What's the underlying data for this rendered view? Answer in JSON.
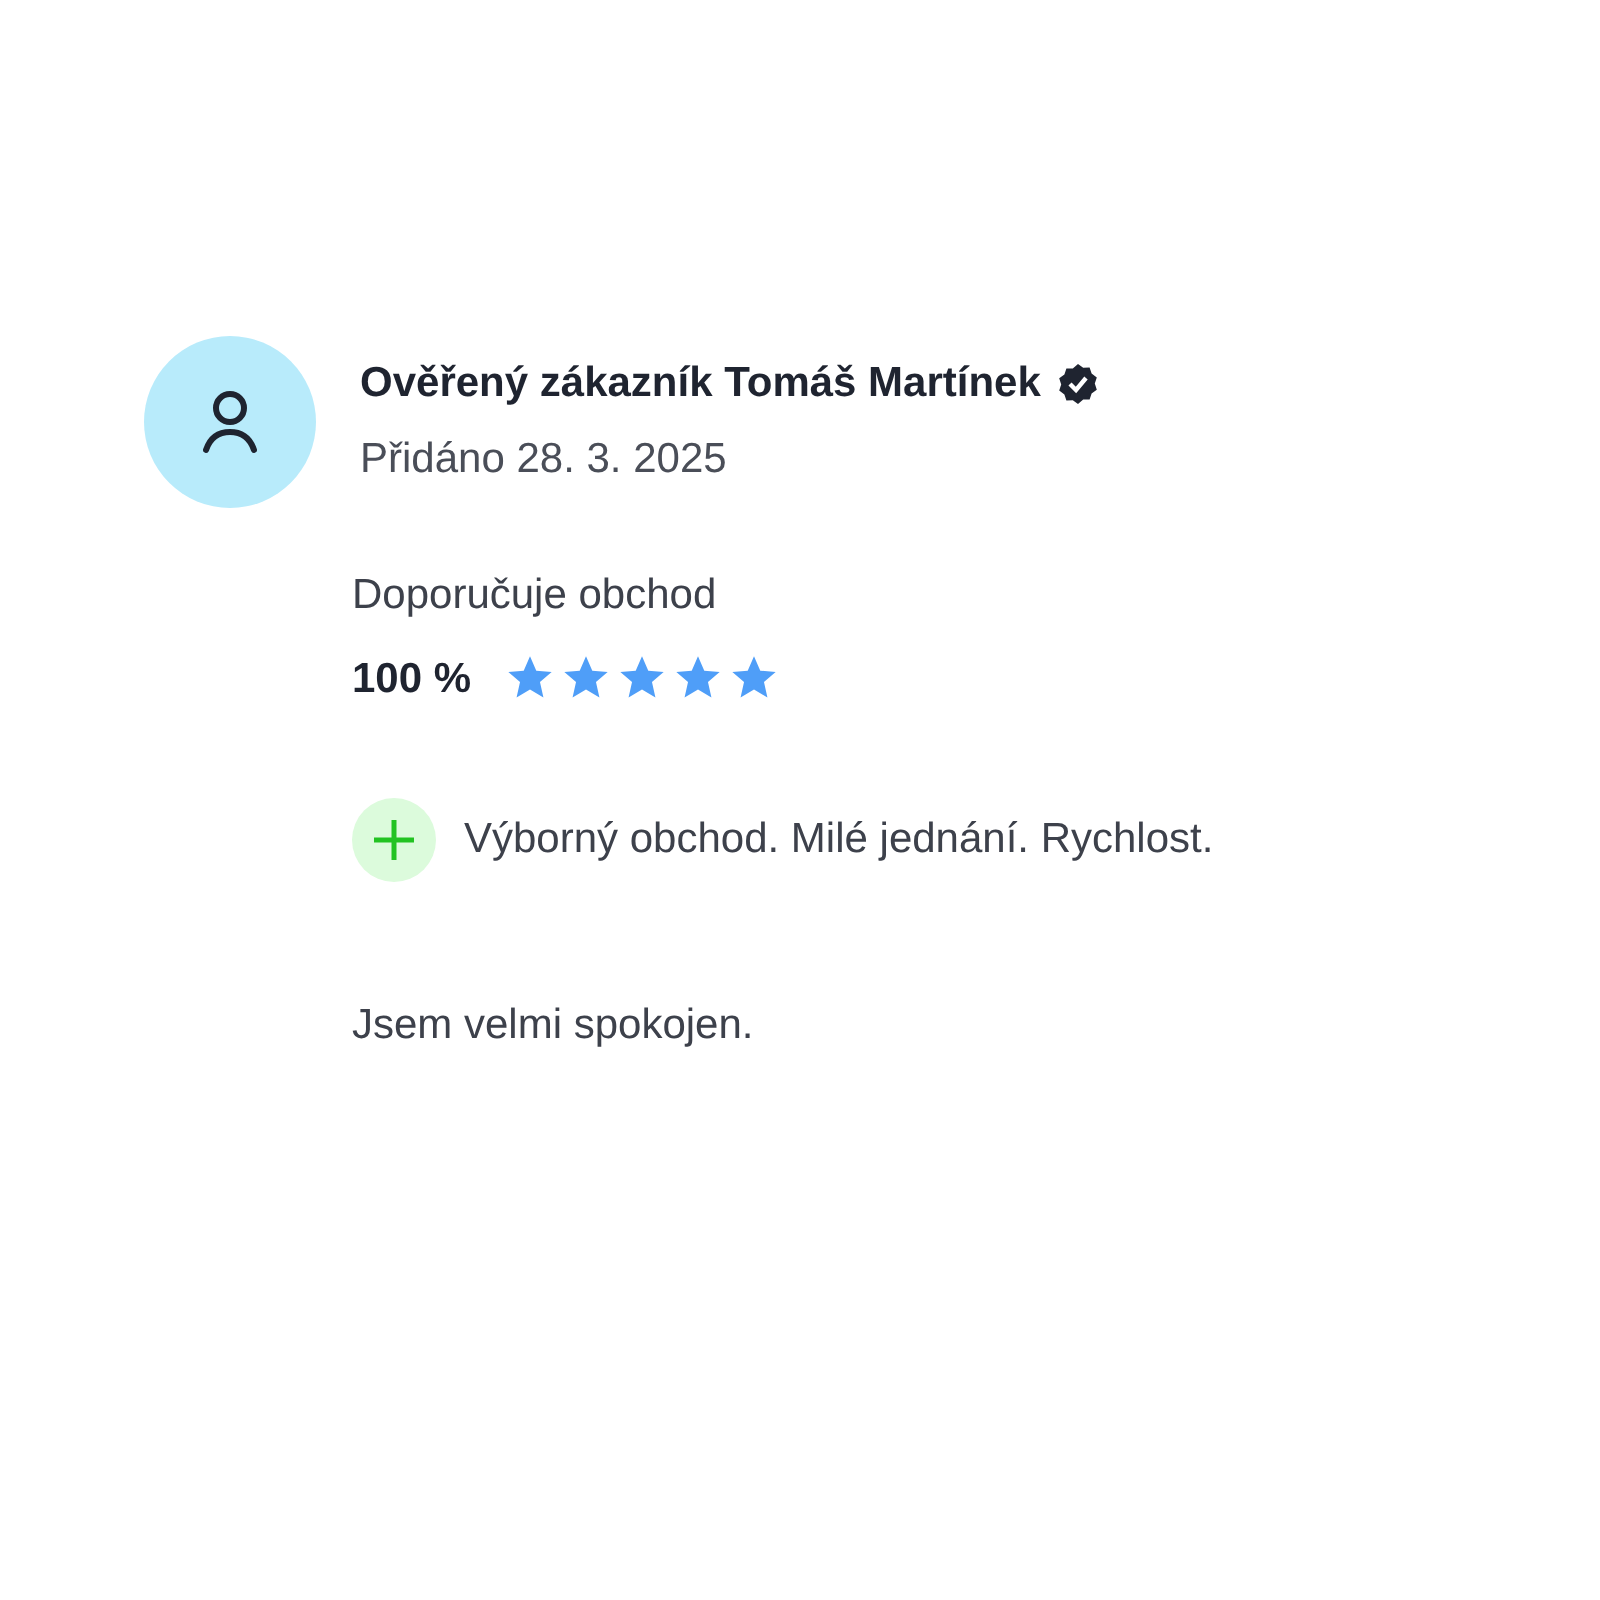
{
  "review": {
    "author": "Ověřený zákazník Tomáš Martínek",
    "verified": true,
    "date": "Přidáno 28. 3. 2025",
    "recommend_label": "Doporučuje obchod",
    "percent": "100 %",
    "stars": 5,
    "points": [
      {
        "kind": "pro",
        "text": "Výborný obchod. Milé jednání. Rychlost."
      }
    ],
    "comment": "Jsem velmi spokojen."
  }
}
